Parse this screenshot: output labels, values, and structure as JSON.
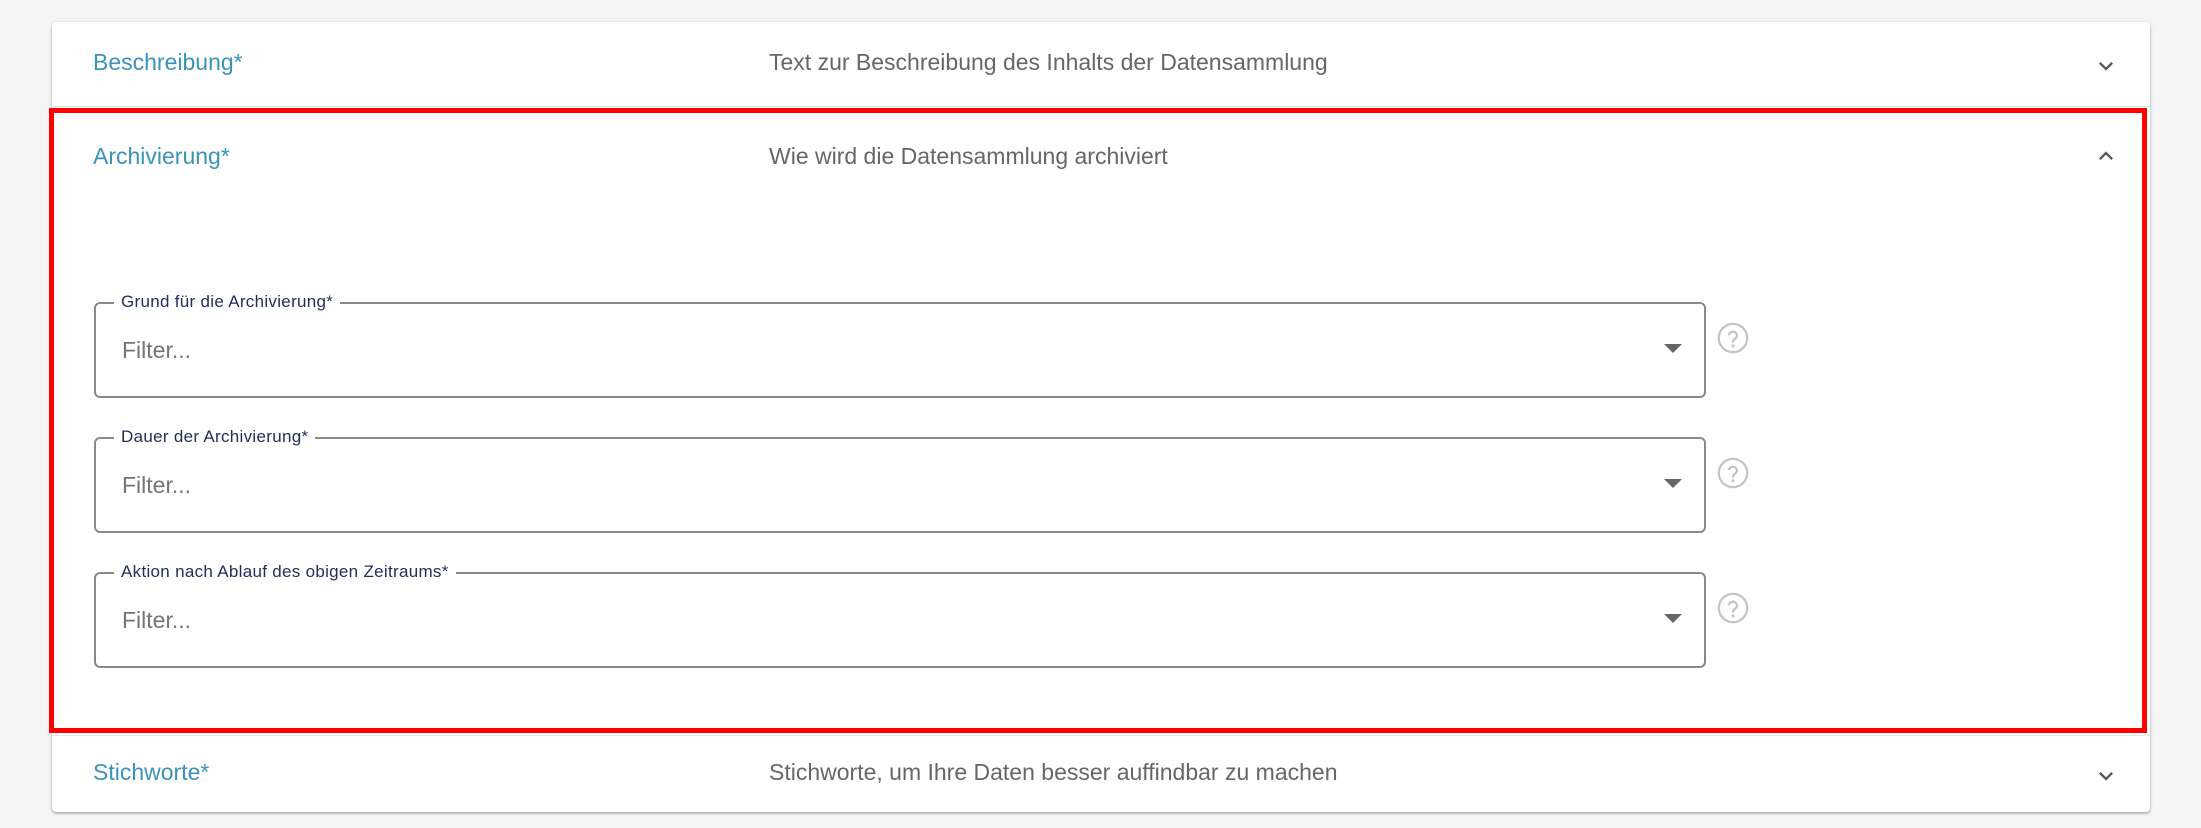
{
  "panels": [
    {
      "title": "Beschreibung*",
      "description": "Text zur Beschreibung des Inhalts der Datensammlung",
      "expanded": false
    },
    {
      "title": "Archivierung*",
      "description": "Wie wird die Datensammlung archiviert",
      "expanded": true,
      "fields": [
        {
          "label": "Grund für die Archivierung*",
          "placeholder": "Filter..."
        },
        {
          "label": "Dauer der Archivierung*",
          "placeholder": "Filter..."
        },
        {
          "label": "Aktion nach Ablauf des obigen Zeitraums*",
          "placeholder": "Filter..."
        }
      ]
    },
    {
      "title": "Stichworte*",
      "description": "Stichworte, um Ihre Daten besser auffindbar zu machen",
      "expanded": false
    }
  ],
  "icons": {
    "expand": "chevron-down-icon",
    "collapse": "chevron-up-icon",
    "dropdown": "caret-down-icon",
    "help": "help-circle-icon"
  },
  "colors": {
    "title": "#3a93b8",
    "description": "#666666",
    "field_label": "#1f2e5a",
    "highlight": "#ff0000"
  }
}
